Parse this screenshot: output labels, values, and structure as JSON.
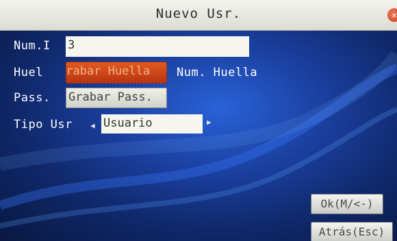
{
  "window": {
    "title": "Nuevo Usr.",
    "close_glyph": "✕"
  },
  "form": {
    "num_label": "Num.I",
    "num_value": "3",
    "huella_label": "Huel",
    "huella_button": "Grabar Huella",
    "huella_count_label": "Num. Huella",
    "pass_label": "Pass.",
    "pass_button": "Grabar Pass.",
    "tipo_label": "Tipo Usr",
    "tipo_value": "Usuario",
    "tipo_left_arrow": "◀",
    "tipo_right_arrow": "▶"
  },
  "buttons": {
    "ok_label": "Ok(M/<-)",
    "back_label": "Atrás(Esc)"
  },
  "colors": {
    "background": "#1a3f9e",
    "selected_field": "#d04a18",
    "titlebar": "#e8e8e0"
  },
  "icons": {
    "close": "close-icon",
    "left": "arrow-left-icon",
    "right": "arrow-right-icon"
  }
}
